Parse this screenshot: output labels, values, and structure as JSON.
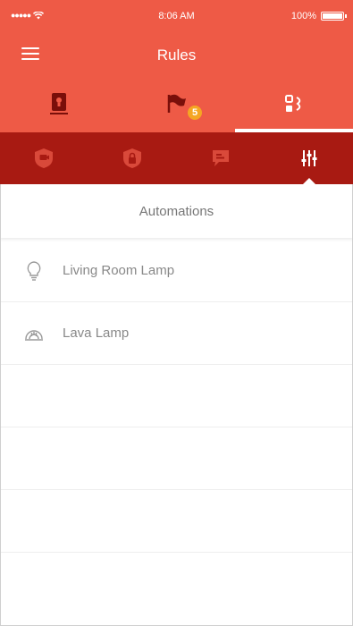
{
  "status_bar": {
    "time": "8:06 AM",
    "battery_text": "100%"
  },
  "navbar": {
    "title": "Rules"
  },
  "primary_tabs": [
    {
      "icon": "sensor-icon",
      "active": false
    },
    {
      "icon": "flag-icon",
      "active": false,
      "badge": "5"
    },
    {
      "icon": "rules-icon",
      "active": true
    }
  ],
  "secondary_tabs": [
    {
      "icon": "shield-camera-icon",
      "active": false
    },
    {
      "icon": "shield-lock-icon",
      "active": false
    },
    {
      "icon": "chat-alert-icon",
      "active": false
    },
    {
      "icon": "sliders-icon",
      "active": true
    }
  ],
  "section": {
    "title": "Automations"
  },
  "automations": [
    {
      "label": "Living Room Lamp",
      "icon": "lightbulb-icon"
    },
    {
      "label": "Lava Lamp",
      "icon": "lava-lamp-icon"
    }
  ],
  "colors": {
    "primary": "#ee5a46",
    "secondary": "#a81a12",
    "badge": "#f5a623"
  }
}
